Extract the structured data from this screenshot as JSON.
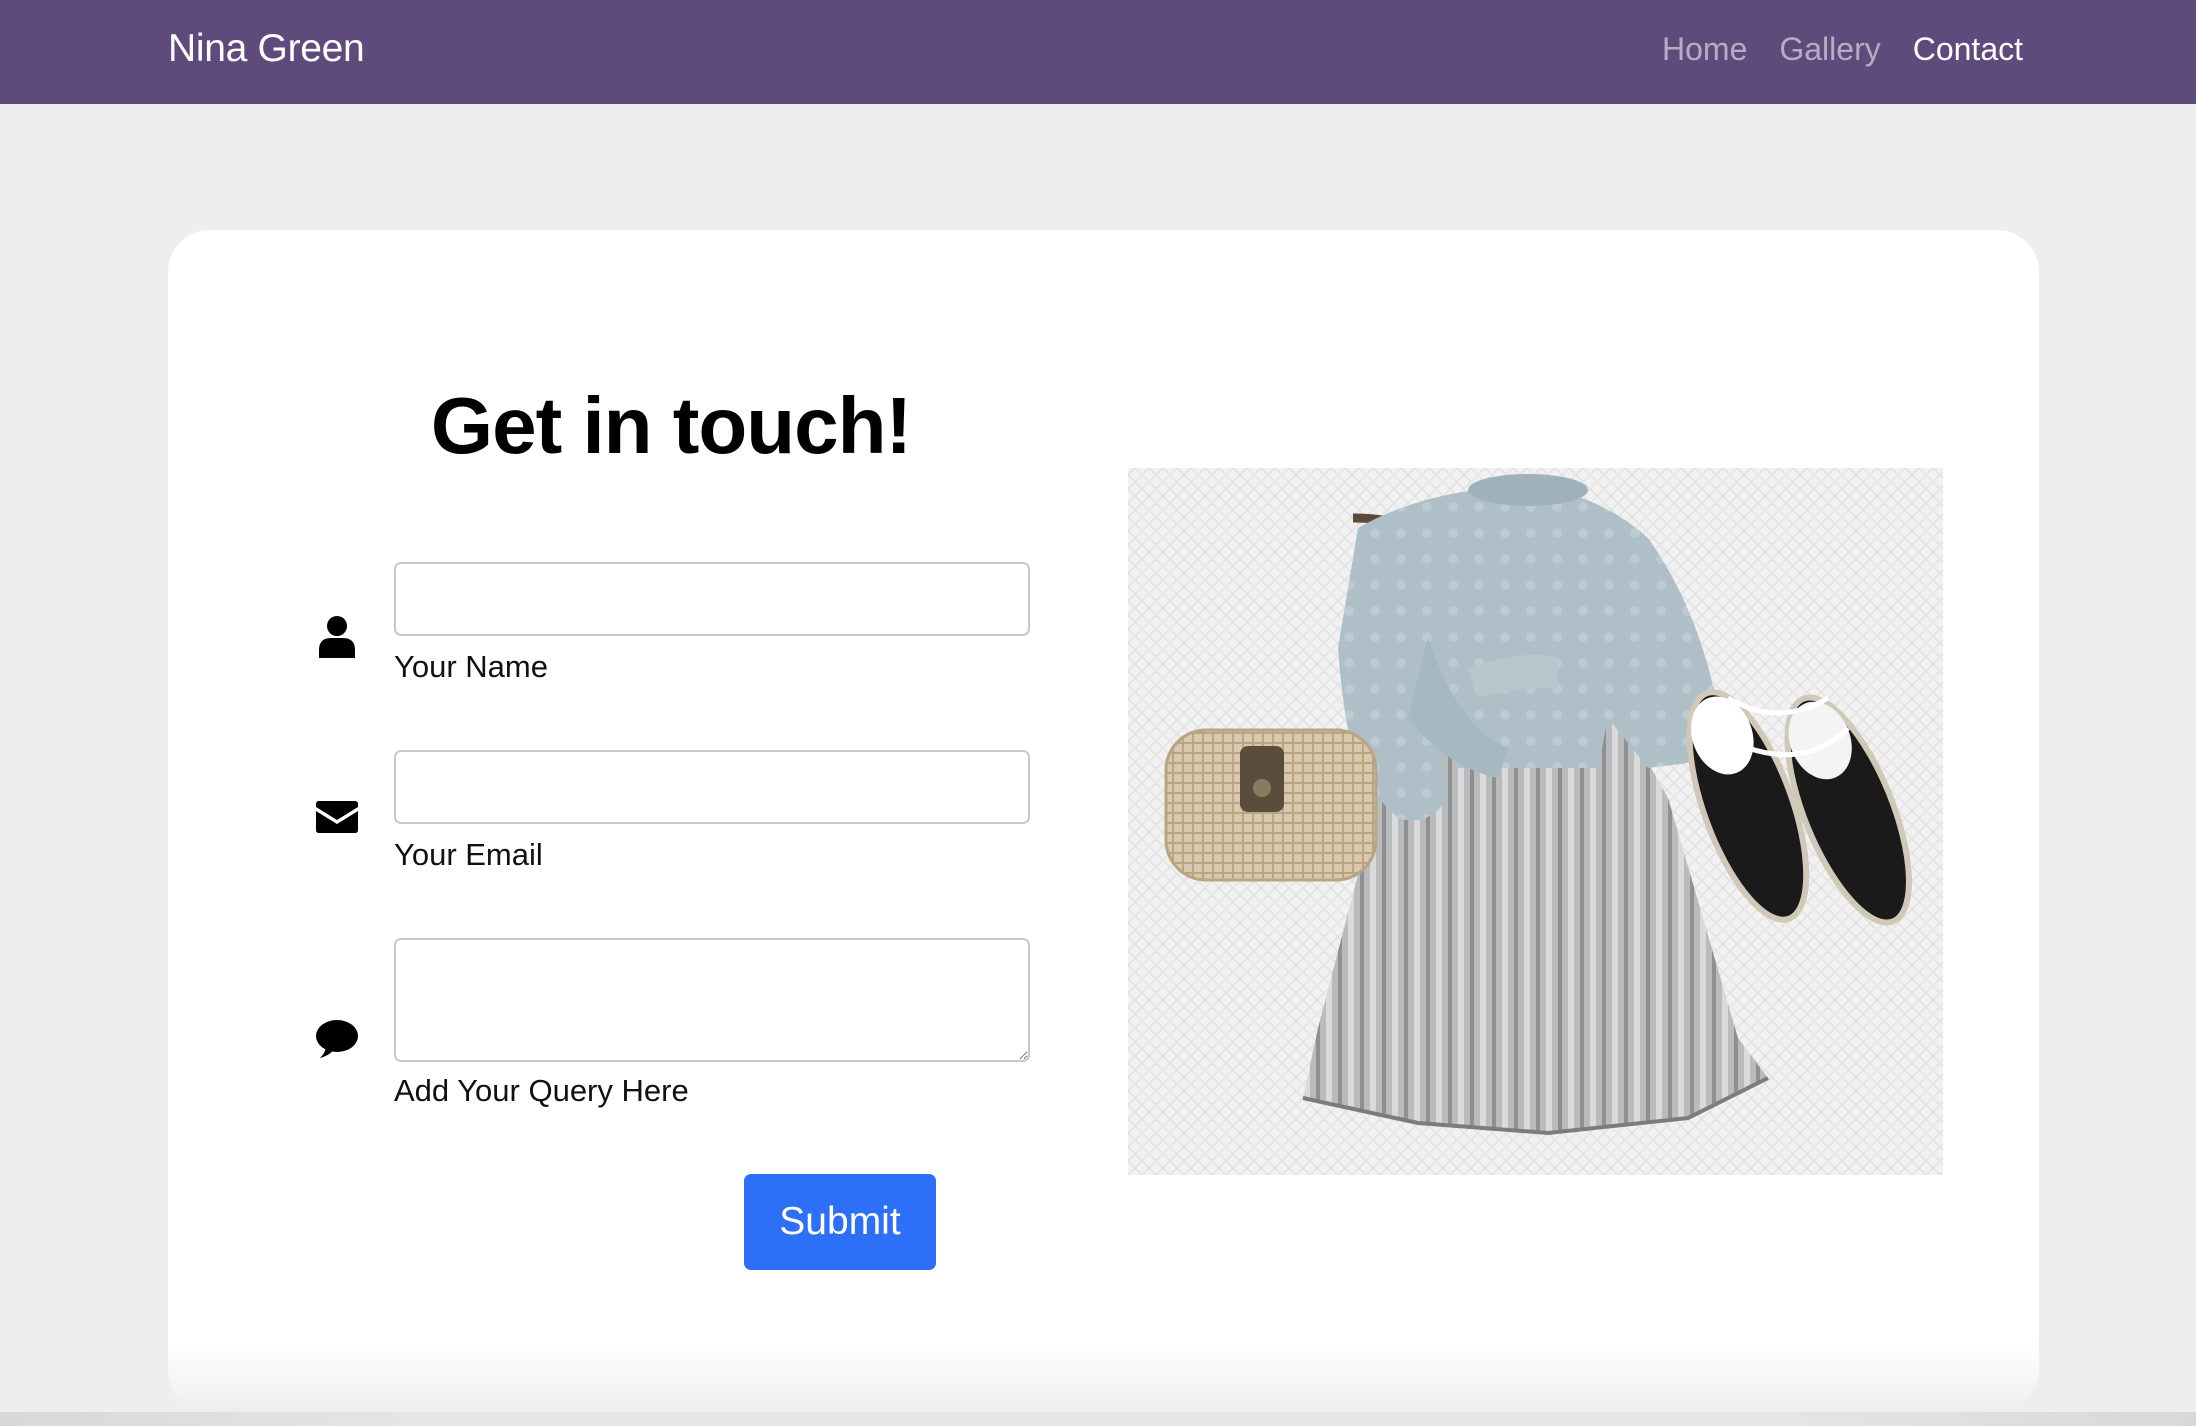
{
  "navbar": {
    "brand": "Nina Green",
    "links": [
      {
        "label": "Home",
        "active": false
      },
      {
        "label": "Gallery",
        "active": false
      },
      {
        "label": "Contact",
        "active": true
      }
    ],
    "background_color": "#5e4a7b"
  },
  "contact": {
    "heading": "Get in touch!",
    "fields": [
      {
        "icon": "user-icon",
        "type": "text",
        "value": "",
        "label": "Your Name"
      },
      {
        "icon": "envelope-icon",
        "type": "email",
        "value": "",
        "label": "Your Email"
      },
      {
        "icon": "comment-icon",
        "type": "textarea",
        "value": "",
        "label": "Add Your Query Here"
      }
    ],
    "submit_label": "Submit",
    "submit_color": "#2d6ff7"
  },
  "image": {
    "subject": "flat-lay outfit: light blue knit sweater, silver pleated skirt, wicker crossbody bag, black espadrille shoes"
  }
}
